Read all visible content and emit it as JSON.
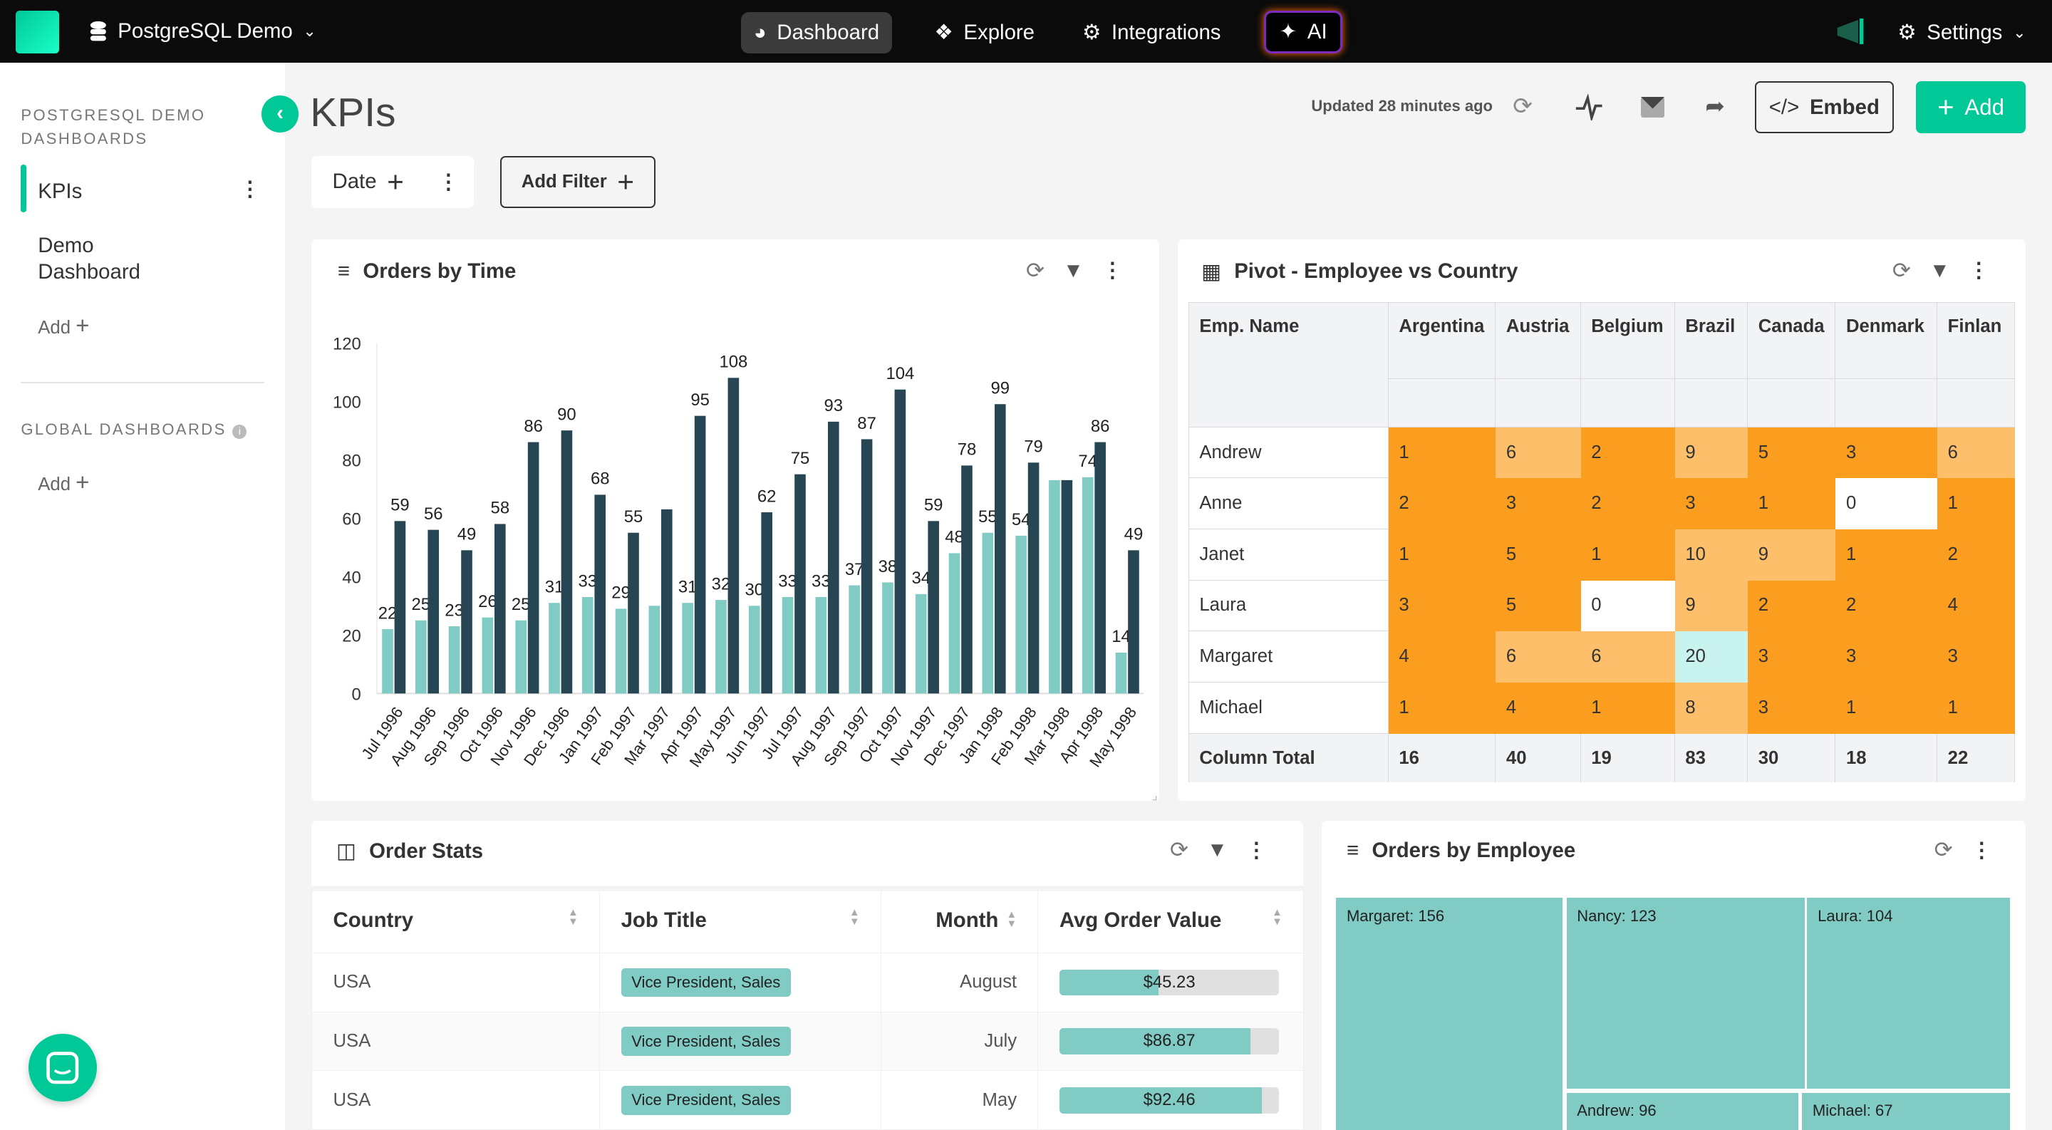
{
  "topbar": {
    "datasource": "PostgreSQL Demo",
    "nav": [
      {
        "label": "Dashboard",
        "icon": "gauge-icon"
      },
      {
        "label": "Explore",
        "icon": "compass-icon"
      },
      {
        "label": "Integrations",
        "icon": "cogs-icon"
      },
      {
        "label": "AI",
        "icon": "sparkle-icon"
      }
    ],
    "settings": "Settings"
  },
  "sidebar": {
    "section1": "POSTGRESQL DEMO DASHBOARDS",
    "items": [
      "KPIs",
      "Demo Dashboard"
    ],
    "add": "Add",
    "section2": "GLOBAL DASHBOARDS",
    "add2": "Add"
  },
  "header": {
    "title": "KPIs",
    "updated": "Updated 28 minutes ago",
    "embed": "Embed",
    "add": "Add",
    "date_filter": "Date",
    "add_filter": "Add Filter"
  },
  "colors": {
    "accent": "#00c896",
    "bar_light": "#80cbc4",
    "bar_dark": "#264653",
    "pivot_high": "#fb9e1f",
    "pivot_mid": "#fdbf69",
    "pivot_top": "#c8f3ef"
  },
  "orders_by_time": {
    "title": "Orders by Time"
  },
  "chart_data": {
    "type": "bar",
    "grouped": true,
    "ylim": [
      0,
      120
    ],
    "yticks": [
      0,
      20,
      40,
      60,
      80,
      100,
      120
    ],
    "grid": false,
    "categories": [
      "Jul 1996",
      "Aug 1996",
      "Sep 1996",
      "Oct 1996",
      "Nov 1996",
      "Dec 1996",
      "Jan 1997",
      "Feb 1997",
      "Mar 1997",
      "Apr 1997",
      "May 1997",
      "Jun 1997",
      "Jul 1997",
      "Aug 1997",
      "Sep 1997",
      "Oct 1997",
      "Nov 1997",
      "Dec 1997",
      "Jan 1998",
      "Feb 1998",
      "Mar 1998",
      "Apr 1998",
      "May 1998"
    ],
    "series": [
      {
        "values": [
          22,
          25,
          23,
          26,
          25,
          31,
          33,
          29,
          30,
          31,
          32,
          30,
          33,
          33,
          37,
          38,
          34,
          48,
          55,
          54,
          73,
          74,
          14
        ],
        "labeled": [
          true,
          true,
          true,
          true,
          true,
          true,
          true,
          true,
          false,
          true,
          true,
          true,
          true,
          true,
          true,
          true,
          true,
          true,
          true,
          true,
          false,
          true,
          true
        ]
      },
      {
        "values": [
          59,
          56,
          49,
          58,
          86,
          90,
          68,
          55,
          63,
          95,
          108,
          62,
          75,
          93,
          87,
          104,
          59,
          78,
          99,
          79,
          73,
          86,
          49
        ],
        "labeled": [
          true,
          true,
          true,
          true,
          true,
          true,
          true,
          true,
          false,
          true,
          true,
          true,
          true,
          true,
          true,
          true,
          true,
          true,
          true,
          true,
          false,
          true,
          true
        ]
      }
    ]
  },
  "pivot": {
    "title": "Pivot - Employee vs Country",
    "row_header": "Emp. Name",
    "columns": [
      "Argentina",
      "Austria",
      "Belgium",
      "Brazil",
      "Canada",
      "Denmark",
      "Finlan"
    ],
    "rows": [
      {
        "name": "Andrew",
        "values": [
          1,
          6,
          2,
          9,
          5,
          3,
          6
        ]
      },
      {
        "name": "Anne",
        "values": [
          2,
          3,
          2,
          3,
          1,
          0,
          1
        ]
      },
      {
        "name": "Janet",
        "values": [
          1,
          5,
          1,
          10,
          9,
          1,
          2
        ]
      },
      {
        "name": "Laura",
        "values": [
          3,
          5,
          0,
          9,
          2,
          2,
          4
        ]
      },
      {
        "name": "Margaret",
        "values": [
          4,
          6,
          6,
          20,
          3,
          3,
          3
        ]
      },
      {
        "name": "Michael",
        "values": [
          1,
          4,
          1,
          8,
          3,
          1,
          1
        ]
      }
    ],
    "total_label": "Column Total",
    "totals": [
      16,
      40,
      19,
      83,
      30,
      18,
      22
    ]
  },
  "order_stats": {
    "title": "Order Stats",
    "columns": [
      "Country",
      "Job Title",
      "Month",
      "Avg Order Value"
    ],
    "rows": [
      {
        "country": "USA",
        "job": "Vice President, Sales",
        "month": "August",
        "avg": "$45.23",
        "fill": 0.45
      },
      {
        "country": "USA",
        "job": "Vice President, Sales",
        "month": "July",
        "avg": "$86.87",
        "fill": 0.87
      },
      {
        "country": "USA",
        "job": "Vice President, Sales",
        "month": "May",
        "avg": "$92.46",
        "fill": 0.92
      }
    ]
  },
  "orders_by_employee": {
    "title": "Orders by Employee",
    "items": [
      {
        "label": "Margaret: 156",
        "value": 156
      },
      {
        "label": "Nancy: 123",
        "value": 123
      },
      {
        "label": "Laura: 104",
        "value": 104
      },
      {
        "label": "Andrew: 96",
        "value": 96
      },
      {
        "label": "Michael: 67",
        "value": 67
      }
    ]
  }
}
